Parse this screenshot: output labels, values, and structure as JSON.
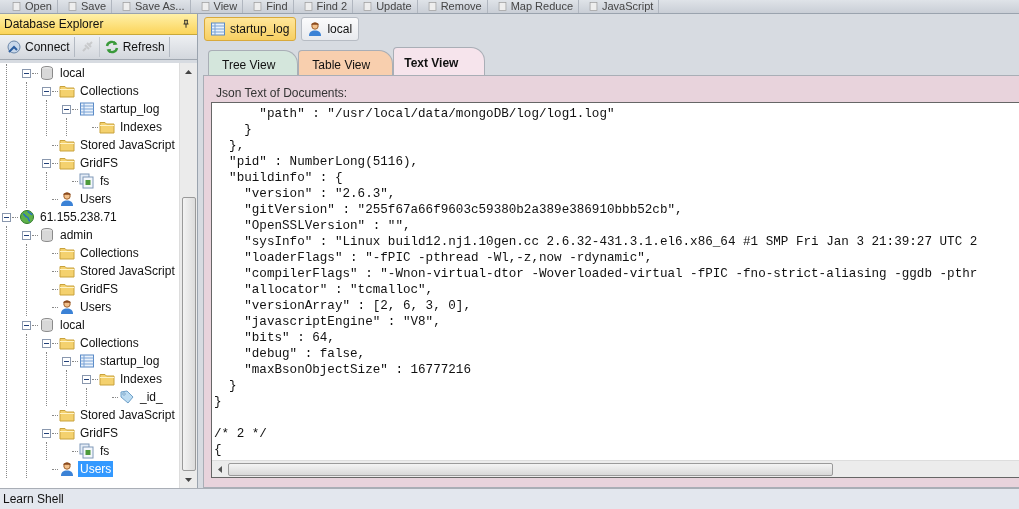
{
  "toolbar": [
    {
      "label": "Open"
    },
    {
      "label": "Save"
    },
    {
      "label": "Save As..."
    },
    {
      "label": "View"
    },
    {
      "label": "Find"
    },
    {
      "label": "Find 2"
    },
    {
      "label": "Update"
    },
    {
      "label": "Remove"
    },
    {
      "label": "Map Reduce"
    },
    {
      "label": "JavaScript"
    }
  ],
  "explorer": {
    "title": "Database Explorer",
    "pinned": true,
    "actions": [
      {
        "kind": "connect",
        "label": "Connect",
        "disabled": false
      },
      {
        "kind": "disconnect",
        "disabled": true
      },
      {
        "kind": "refresh",
        "label": "Refresh",
        "disabled": false
      }
    ],
    "tree": [
      {
        "children": [
          {
            "kind": "database",
            "label": "local",
            "expanded": true,
            "selected": false,
            "children": [
              {
                "kind": "folder",
                "label": "Collections",
                "expanded": true,
                "selected": false,
                "children": [
                  {
                    "kind": "collection",
                    "label": "startup_log",
                    "expanded": true,
                    "selected": false,
                    "children": [
                      {
                        "kind": "folder",
                        "label": "Indexes",
                        "selected": false
                      }
                    ]
                  }
                ]
              },
              {
                "kind": "folder",
                "label": "Stored JavaScript",
                "selected": false
              },
              {
                "kind": "folder",
                "label": "GridFS",
                "expanded": true,
                "selected": false,
                "children": [
                  {
                    "kind": "file",
                    "label": "fs",
                    "selected": false
                  }
                ]
              },
              {
                "kind": "user",
                "label": "Users",
                "selected": false
              }
            ]
          }
        ]
      },
      {
        "kind": "server",
        "label": "61.155.238.71",
        "expanded": true,
        "selected": false,
        "children": [
          {
            "kind": "database",
            "label": "admin",
            "expanded": true,
            "selected": false,
            "children": [
              {
                "kind": "folder",
                "label": "Collections",
                "selected": false
              },
              {
                "kind": "folder",
                "label": "Stored JavaScript",
                "selected": false
              },
              {
                "kind": "folder",
                "label": "GridFS",
                "selected": false
              },
              {
                "kind": "user",
                "label": "Users",
                "selected": false
              }
            ]
          },
          {
            "kind": "database",
            "label": "local",
            "expanded": true,
            "selected": false,
            "children": [
              {
                "kind": "folder",
                "label": "Collections",
                "expanded": true,
                "selected": false,
                "children": [
                  {
                    "kind": "collection",
                    "label": "startup_log",
                    "expanded": true,
                    "selected": false,
                    "children": [
                      {
                        "kind": "folder",
                        "label": "Indexes",
                        "expanded": true,
                        "selected": false,
                        "children": [
                          {
                            "kind": "index",
                            "label": "_id_",
                            "selected": false
                          }
                        ]
                      }
                    ]
                  }
                ]
              },
              {
                "kind": "folder",
                "label": "Stored JavaScript",
                "selected": false
              },
              {
                "kind": "folder",
                "label": "GridFS",
                "expanded": true,
                "selected": false,
                "children": [
                  {
                    "kind": "file",
                    "label": "fs",
                    "selected": false
                  }
                ]
              },
              {
                "kind": "user",
                "label": "Users",
                "selected": true
              }
            ]
          }
        ]
      }
    ]
  },
  "doc_tabs": [
    {
      "kind": "collection",
      "label": "startup_log",
      "selected": true
    },
    {
      "kind": "user",
      "label": "local",
      "selected": false
    }
  ],
  "view_tabs": [
    {
      "label": "Tree View",
      "color": "#d4e6dc",
      "selected": false
    },
    {
      "label": "Table View",
      "color": "#f8cfae",
      "selected": false
    },
    {
      "label": "Text View",
      "color": "#f6e4ec",
      "selected": true
    }
  ],
  "text_panel": {
    "label": "Json Text of Documents:",
    "text": "      \"path\" : \"/usr/local/data/mongoDB/log/log1.log\"\n    }\n  },\n  \"pid\" : NumberLong(5116),\n  \"buildinfo\" : {\n    \"version\" : \"2.6.3\",\n    \"gitVersion\" : \"255f67a66f9603c59380b2a389e386910bbb52cb\",\n    \"OpenSSLVersion\" : \"\",\n    \"sysInfo\" : \"Linux build12.nj1.10gen.cc 2.6.32-431.3.1.el6.x86_64 #1 SMP Fri Jan 3 21:39:27 UTC 2\n    \"loaderFlags\" : \"-fPIC -pthread -Wl,-z,now -rdynamic\",\n    \"compilerFlags\" : \"-Wnon-virtual-dtor -Woverloaded-virtual -fPIC -fno-strict-aliasing -ggdb -pthr\n    \"allocator\" : \"tcmalloc\",\n    \"versionArray\" : [2, 6, 3, 0],\n    \"javascriptEngine\" : \"V8\",\n    \"bits\" : 64,\n    \"debug\" : false,\n    \"maxBsonObjectSize\" : 16777216\n  }\n}\n\n/* 2 */\n{"
  },
  "status_bar": {
    "text": "Learn Shell"
  }
}
